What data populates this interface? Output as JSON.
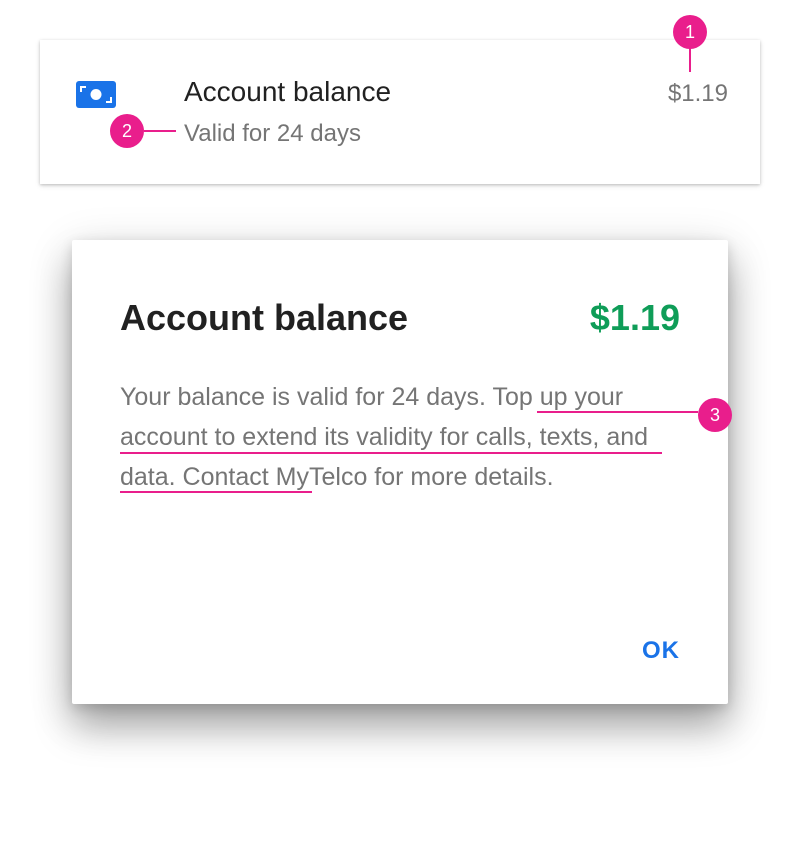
{
  "card": {
    "icon": "money-icon",
    "title": "Account balance",
    "subtitle": "Valid for 24 days",
    "amount": "$1.19"
  },
  "dialog": {
    "title": "Account balance",
    "amount": "$1.19",
    "body_lead": "Your balance is valid for 24 days. ",
    "body_highlight": "Top up your account to extend its validity for calls, texts, and data.",
    "body_tail": " Contact MyTelco for more details.",
    "ok_label": "OK"
  },
  "annotations": {
    "marker_1": "1",
    "marker_2": "2",
    "marker_3": "3"
  },
  "colors": {
    "accent_blue": "#1a73e8",
    "amount_green": "#0f9d58",
    "annotation_pink": "#e91e8c",
    "secondary_text": "#757575",
    "primary_text": "#212121"
  }
}
